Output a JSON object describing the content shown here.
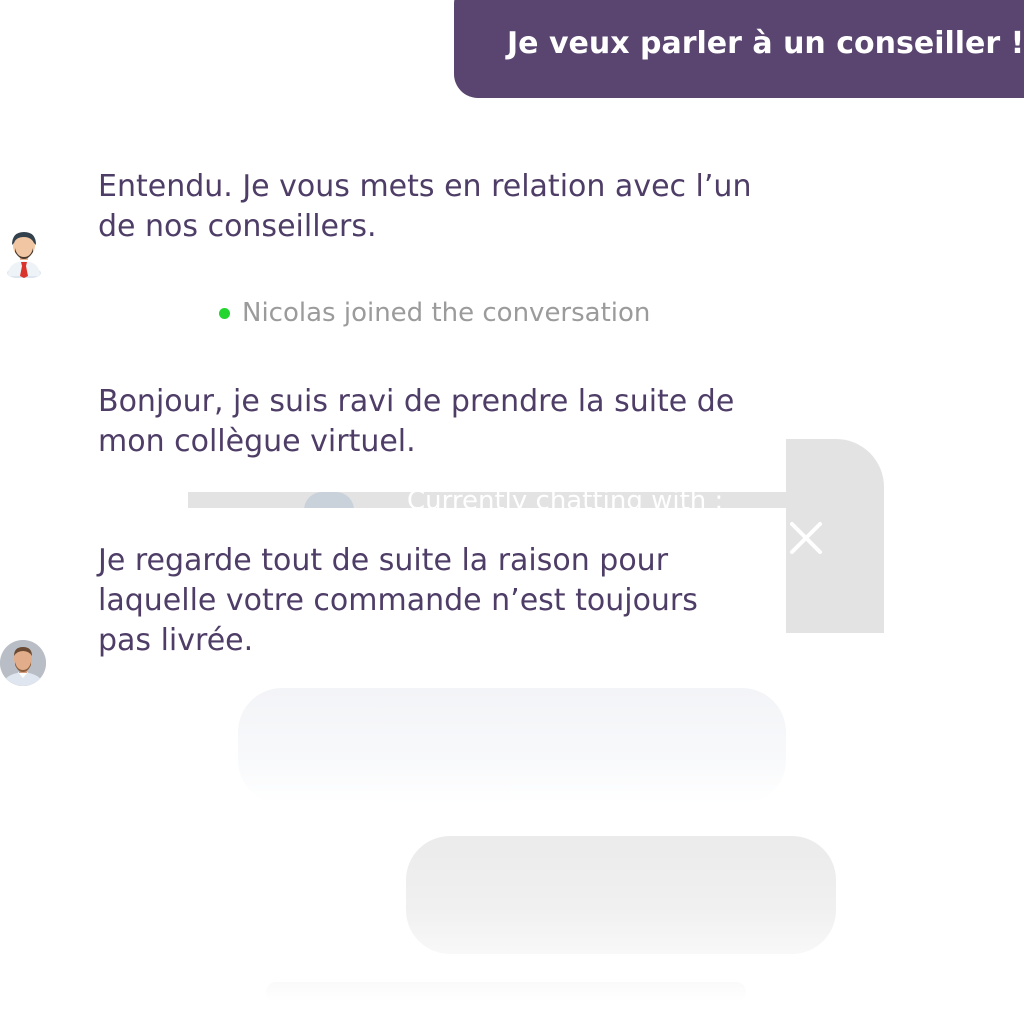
{
  "user_message": {
    "text": "Je veux parler à un conseiller !"
  },
  "messages": [
    {
      "text": "Entendu. Je vous mets en relation avec l’un de nos conseillers."
    },
    {
      "text": "Bonjour, je suis ravi de prendre la suite de mon collègue virtuel."
    },
    {
      "text": "Je regarde tout de suite la raison pour laquelle votre commande n’est toujours pas livrée."
    }
  ],
  "join_notice": {
    "text": "Nicolas joined the conversation",
    "dot_color": "#22d62f"
  },
  "overlay": {
    "header_text": "Currently chatting with :"
  },
  "colors": {
    "accent": "#5a4570",
    "message_text": "#4e3d66"
  },
  "icons": {
    "bot": "bot-avatar-icon",
    "agent": "agent-avatar-icon",
    "close": "close-icon"
  }
}
